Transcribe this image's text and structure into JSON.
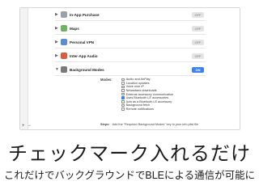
{
  "capabilities": [
    {
      "title": "In-App Purchase",
      "toggle": "OFF",
      "icon_color": "#9aa1ab"
    },
    {
      "title": "Maps",
      "toggle": "OFF",
      "icon_color": "#6cb35f"
    },
    {
      "title": "Personal VPN",
      "toggle": "OFF",
      "icon_color": "#5a8fd6"
    },
    {
      "title": "Inter-App Audio",
      "toggle": "OFF",
      "icon_color": "#e0593f"
    },
    {
      "title": "Background Modes",
      "toggle": "ON",
      "icon_color": "#7a7a7a"
    }
  ],
  "background_modes": {
    "label": "Modes:",
    "options": [
      {
        "label": "Audio and AirPlay",
        "checked": false
      },
      {
        "label": "Location updates",
        "checked": false
      },
      {
        "label": "Voice over IP",
        "checked": false
      },
      {
        "label": "Newsstand downloads",
        "checked": false
      },
      {
        "label": "External accessory communication",
        "checked": false
      },
      {
        "label": "Uses Bluetooth LE accessories",
        "checked": true
      },
      {
        "label": "Acts as a Bluetooth LE accessory",
        "checked": false
      },
      {
        "label": "Background fetch",
        "checked": false
      },
      {
        "label": "Remote notifications",
        "checked": false
      }
    ],
    "steps_label": "Steps:",
    "steps_text": "Add the \"Required Background Modes\" key to your info plist file"
  },
  "sidebar_footer": {
    "add": "+",
    "remove": "−"
  },
  "headline": "チェックマーク入れるだけ",
  "subline": "これだけでバックグラウンドでBLEによる通信が可能に"
}
